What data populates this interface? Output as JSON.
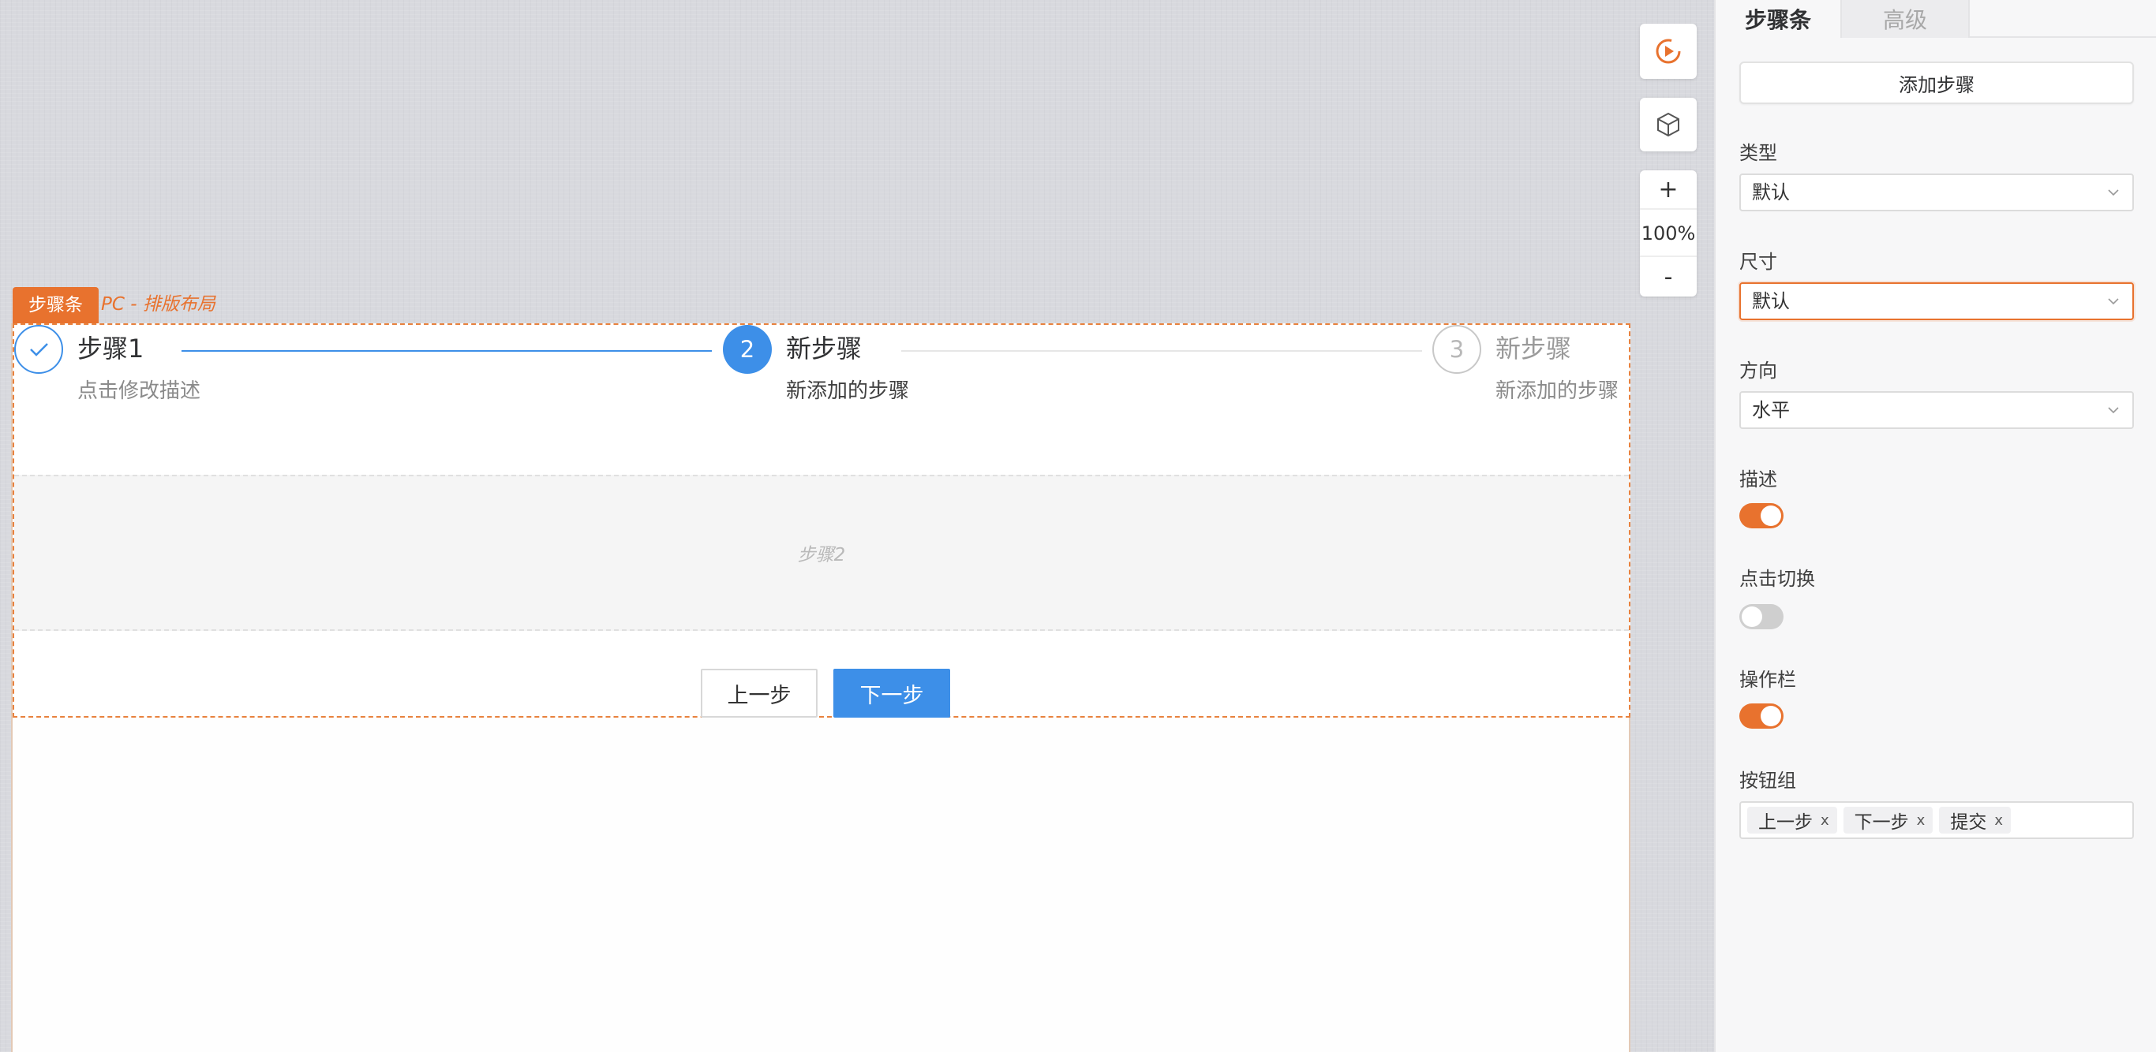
{
  "selection": {
    "tag_label": "步骤条",
    "path_label": "PC - 排版布局"
  },
  "steps_component": {
    "steps": [
      {
        "number": "1",
        "status": "done",
        "title": "步骤1",
        "description": "点击修改描述"
      },
      {
        "number": "2",
        "status": "active",
        "title": "新步骤",
        "description": "新添加的步骤"
      },
      {
        "number": "3",
        "status": "wait",
        "title": "新步骤",
        "description": "新添加的步骤"
      }
    ],
    "content_placeholder": "步骤2",
    "actions": {
      "prev_label": "上一步",
      "next_label": "下一步"
    }
  },
  "tools": {
    "preview_icon": "play-circle-icon",
    "cube_icon": "cube-icon",
    "zoom_in_label": "+",
    "zoom_level": "100%",
    "zoom_out_label": "-"
  },
  "panel": {
    "tabs": [
      {
        "label": "步骤条",
        "active": true
      },
      {
        "label": "高级",
        "active": false
      }
    ],
    "add_step_label": "添加步骤",
    "fields": {
      "type": {
        "label": "类型",
        "value": "默认"
      },
      "size": {
        "label": "尺寸",
        "value": "默认"
      },
      "direction": {
        "label": "方向",
        "value": "水平"
      },
      "description": {
        "label": "描述",
        "on": true
      },
      "click_switch": {
        "label": "点击切换",
        "on": false
      },
      "action_bar": {
        "label": "操作栏",
        "on": true
      },
      "button_group": {
        "label": "按钮组",
        "tags": [
          "上一步",
          "下一步",
          "提交"
        ],
        "remove_glyph": "x"
      }
    }
  },
  "colors": {
    "accent": "#e8722e",
    "primary": "#3d8fe8"
  }
}
